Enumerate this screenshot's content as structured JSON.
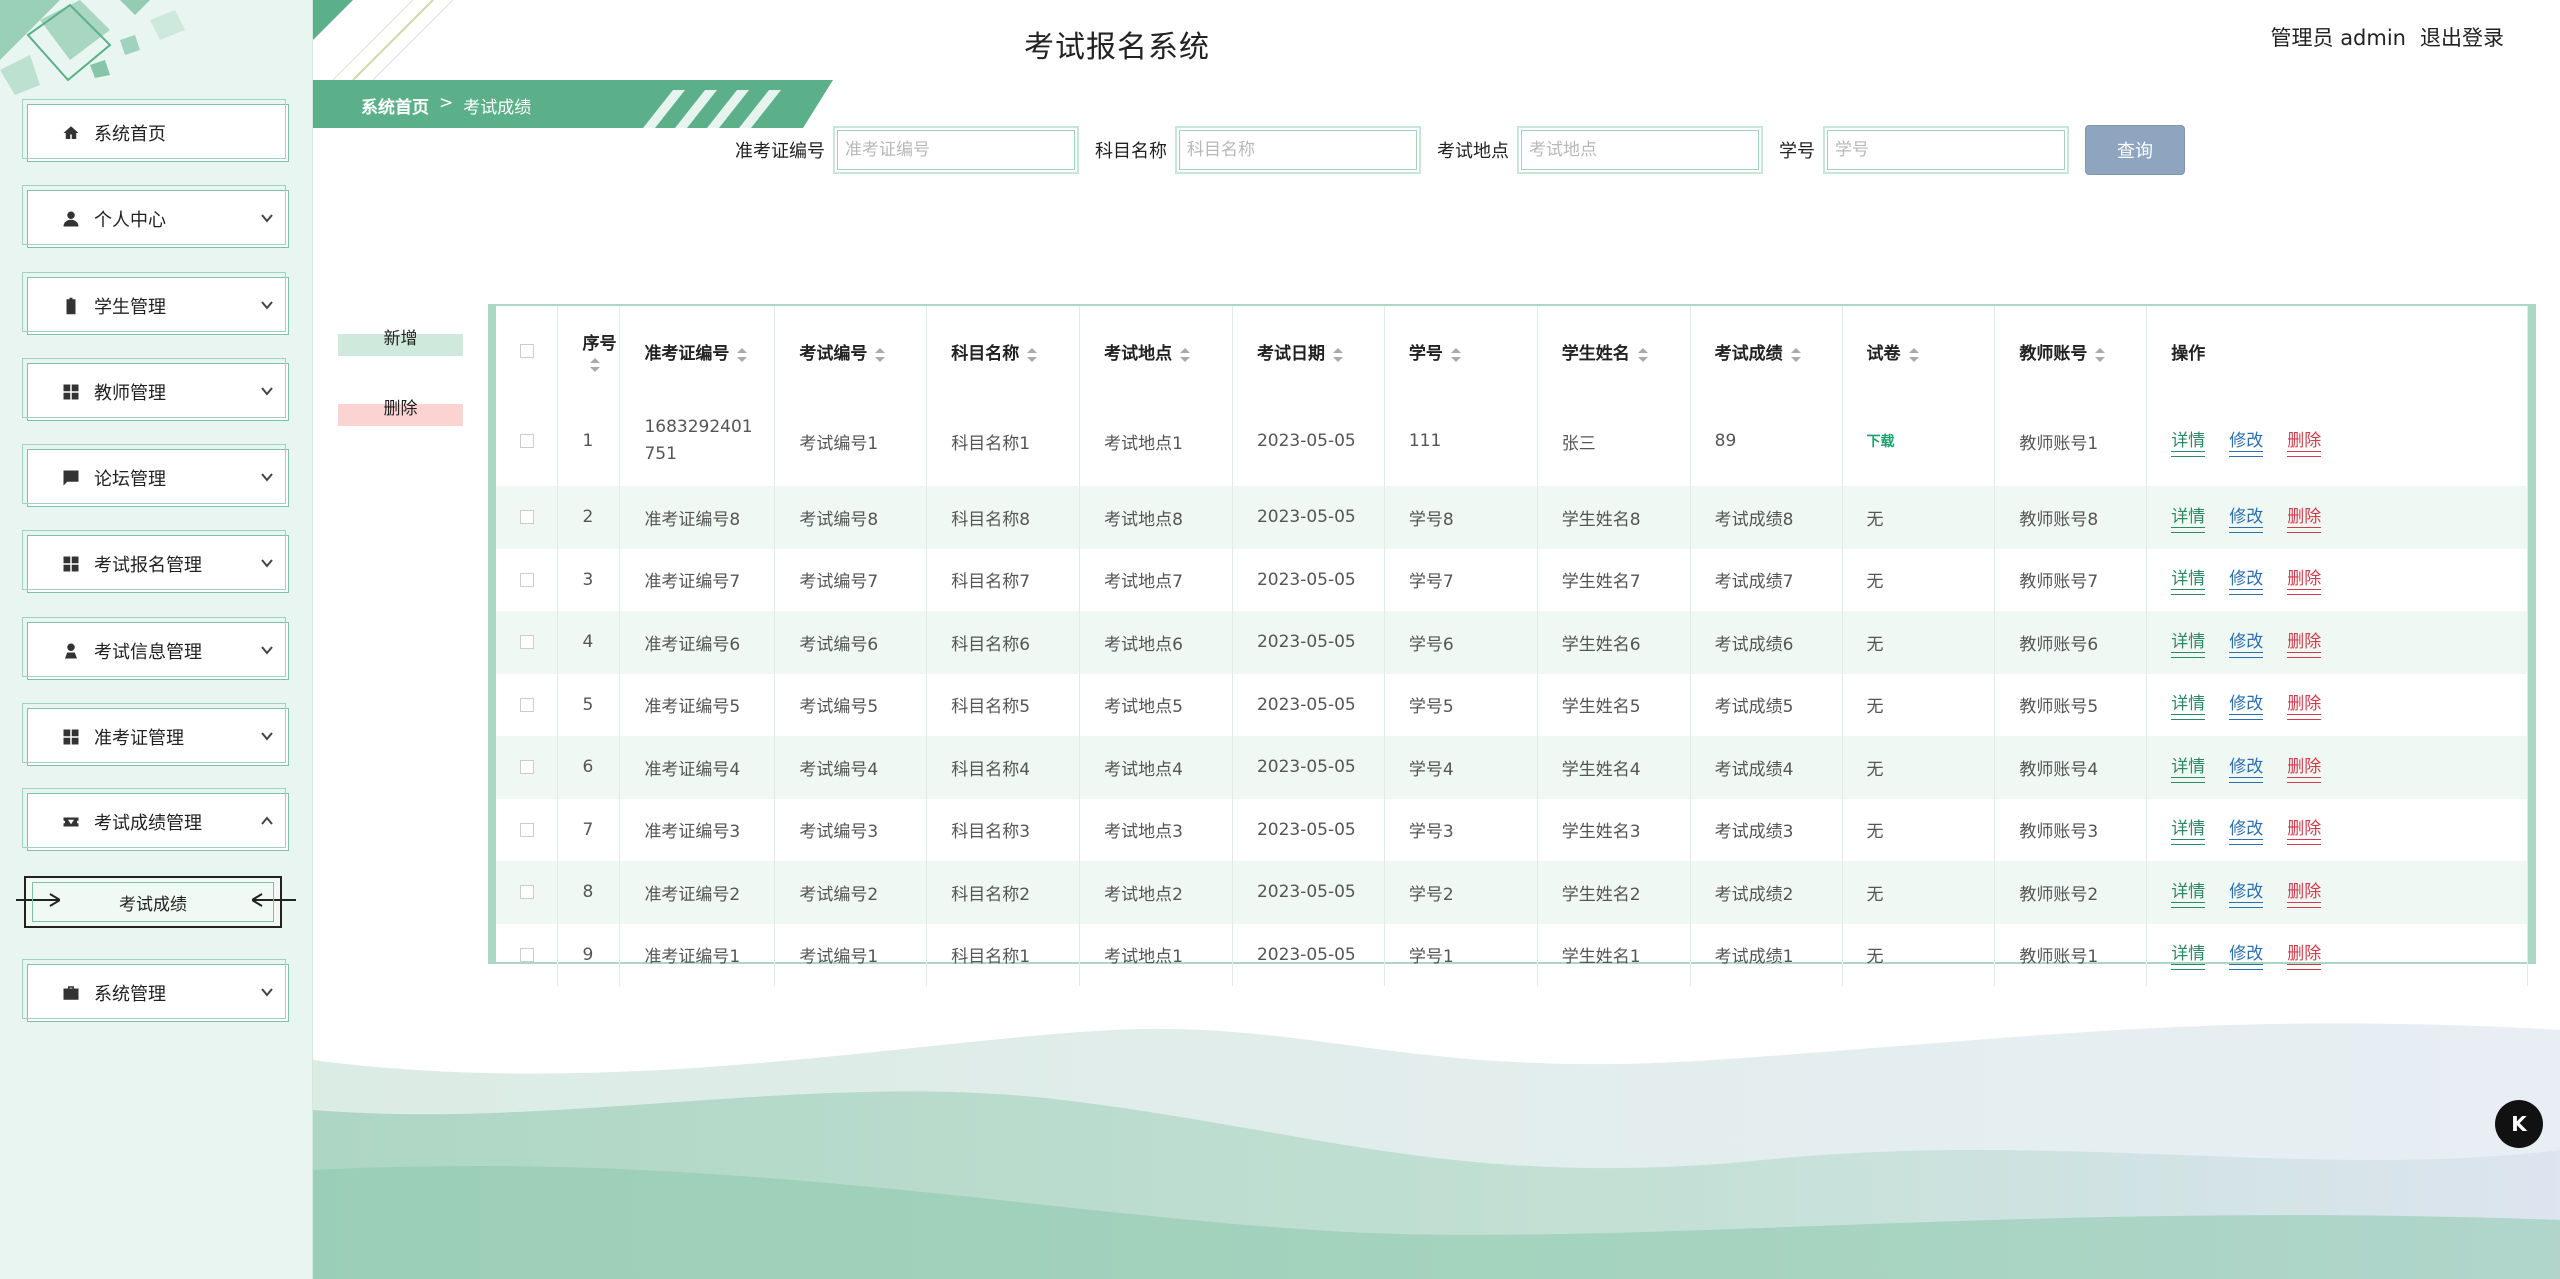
{
  "app": {
    "title": "考试报名系统"
  },
  "user": {
    "role_name": "管理员 admin",
    "logout": "退出登录"
  },
  "breadcrumb": {
    "home": "系统首页",
    "sep": ">",
    "current": "考试成绩"
  },
  "sidebar": {
    "items": [
      {
        "label": "系统首页",
        "icon": "home-icon"
      },
      {
        "label": "个人中心",
        "icon": "user-icon"
      },
      {
        "label": "学生管理",
        "icon": "clipboard-icon"
      },
      {
        "label": "教师管理",
        "icon": "grid-icon"
      },
      {
        "label": "论坛管理",
        "icon": "chat-icon"
      },
      {
        "label": "考试报名管理",
        "icon": "grid-icon"
      },
      {
        "label": "考试信息管理",
        "icon": "person-pin-icon"
      },
      {
        "label": "准考证管理",
        "icon": "grid-icon"
      },
      {
        "label": "考试成绩管理",
        "icon": "ticket-icon"
      },
      {
        "label": "系统管理",
        "icon": "briefcase-icon"
      }
    ],
    "sub_item": "考试成绩"
  },
  "search": {
    "fields": [
      {
        "label": "准考证编号",
        "placeholder": "准考证编号"
      },
      {
        "label": "科目名称",
        "placeholder": "科目名称"
      },
      {
        "label": "考试地点",
        "placeholder": "考试地点"
      },
      {
        "label": "学号",
        "placeholder": "学号"
      }
    ],
    "button": "查询"
  },
  "actions": {
    "add": "新增",
    "delete": "删除"
  },
  "table": {
    "columns": [
      "序号",
      "准考证编号",
      "考试编号",
      "科目名称",
      "考试地点",
      "考试日期",
      "学号",
      "学生姓名",
      "考试成绩",
      "试卷",
      "教师账号",
      "操作"
    ],
    "ops": {
      "view": "详情",
      "edit": "修改",
      "delete": "删除"
    },
    "rows": [
      [
        "1",
        "1683292401751",
        "考试编号1",
        "科目名称1",
        "考试地点1",
        "2023-05-05",
        "111",
        "张三",
        "89",
        "下载",
        "教师账号1"
      ],
      [
        "2",
        "准考证编号8",
        "考试编号8",
        "科目名称8",
        "考试地点8",
        "2023-05-05",
        "学号8",
        "学生姓名8",
        "考试成绩8",
        "无",
        "教师账号8"
      ],
      [
        "3",
        "准考证编号7",
        "考试编号7",
        "科目名称7",
        "考试地点7",
        "2023-05-05",
        "学号7",
        "学生姓名7",
        "考试成绩7",
        "无",
        "教师账号7"
      ],
      [
        "4",
        "准考证编号6",
        "考试编号6",
        "科目名称6",
        "考试地点6",
        "2023-05-05",
        "学号6",
        "学生姓名6",
        "考试成绩6",
        "无",
        "教师账号6"
      ],
      [
        "5",
        "准考证编号5",
        "考试编号5",
        "科目名称5",
        "考试地点5",
        "2023-05-05",
        "学号5",
        "学生姓名5",
        "考试成绩5",
        "无",
        "教师账号5"
      ],
      [
        "6",
        "准考证编号4",
        "考试编号4",
        "科目名称4",
        "考试地点4",
        "2023-05-05",
        "学号4",
        "学生姓名4",
        "考试成绩4",
        "无",
        "教师账号4"
      ],
      [
        "7",
        "准考证编号3",
        "考试编号3",
        "科目名称3",
        "考试地点3",
        "2023-05-05",
        "学号3",
        "学生姓名3",
        "考试成绩3",
        "无",
        "教师账号3"
      ],
      [
        "8",
        "准考证编号2",
        "考试编号2",
        "科目名称2",
        "考试地点2",
        "2023-05-05",
        "学号2",
        "学生姓名2",
        "考试成绩2",
        "无",
        "教师账号2"
      ],
      [
        "9",
        "准考证编号1",
        "考试编号1",
        "科目名称1",
        "考试地点1",
        "2023-05-05",
        "学号1",
        "学生姓名1",
        "考试成绩1",
        "无",
        "教师账号1"
      ]
    ]
  },
  "colors": {
    "accent": "#5bb08a",
    "sidebar_bg": "#e9f5f0",
    "query_btn": "#8ea4bf",
    "delete": "#d23c4c",
    "edit": "#2c6fb1",
    "view": "#2b8a64"
  }
}
